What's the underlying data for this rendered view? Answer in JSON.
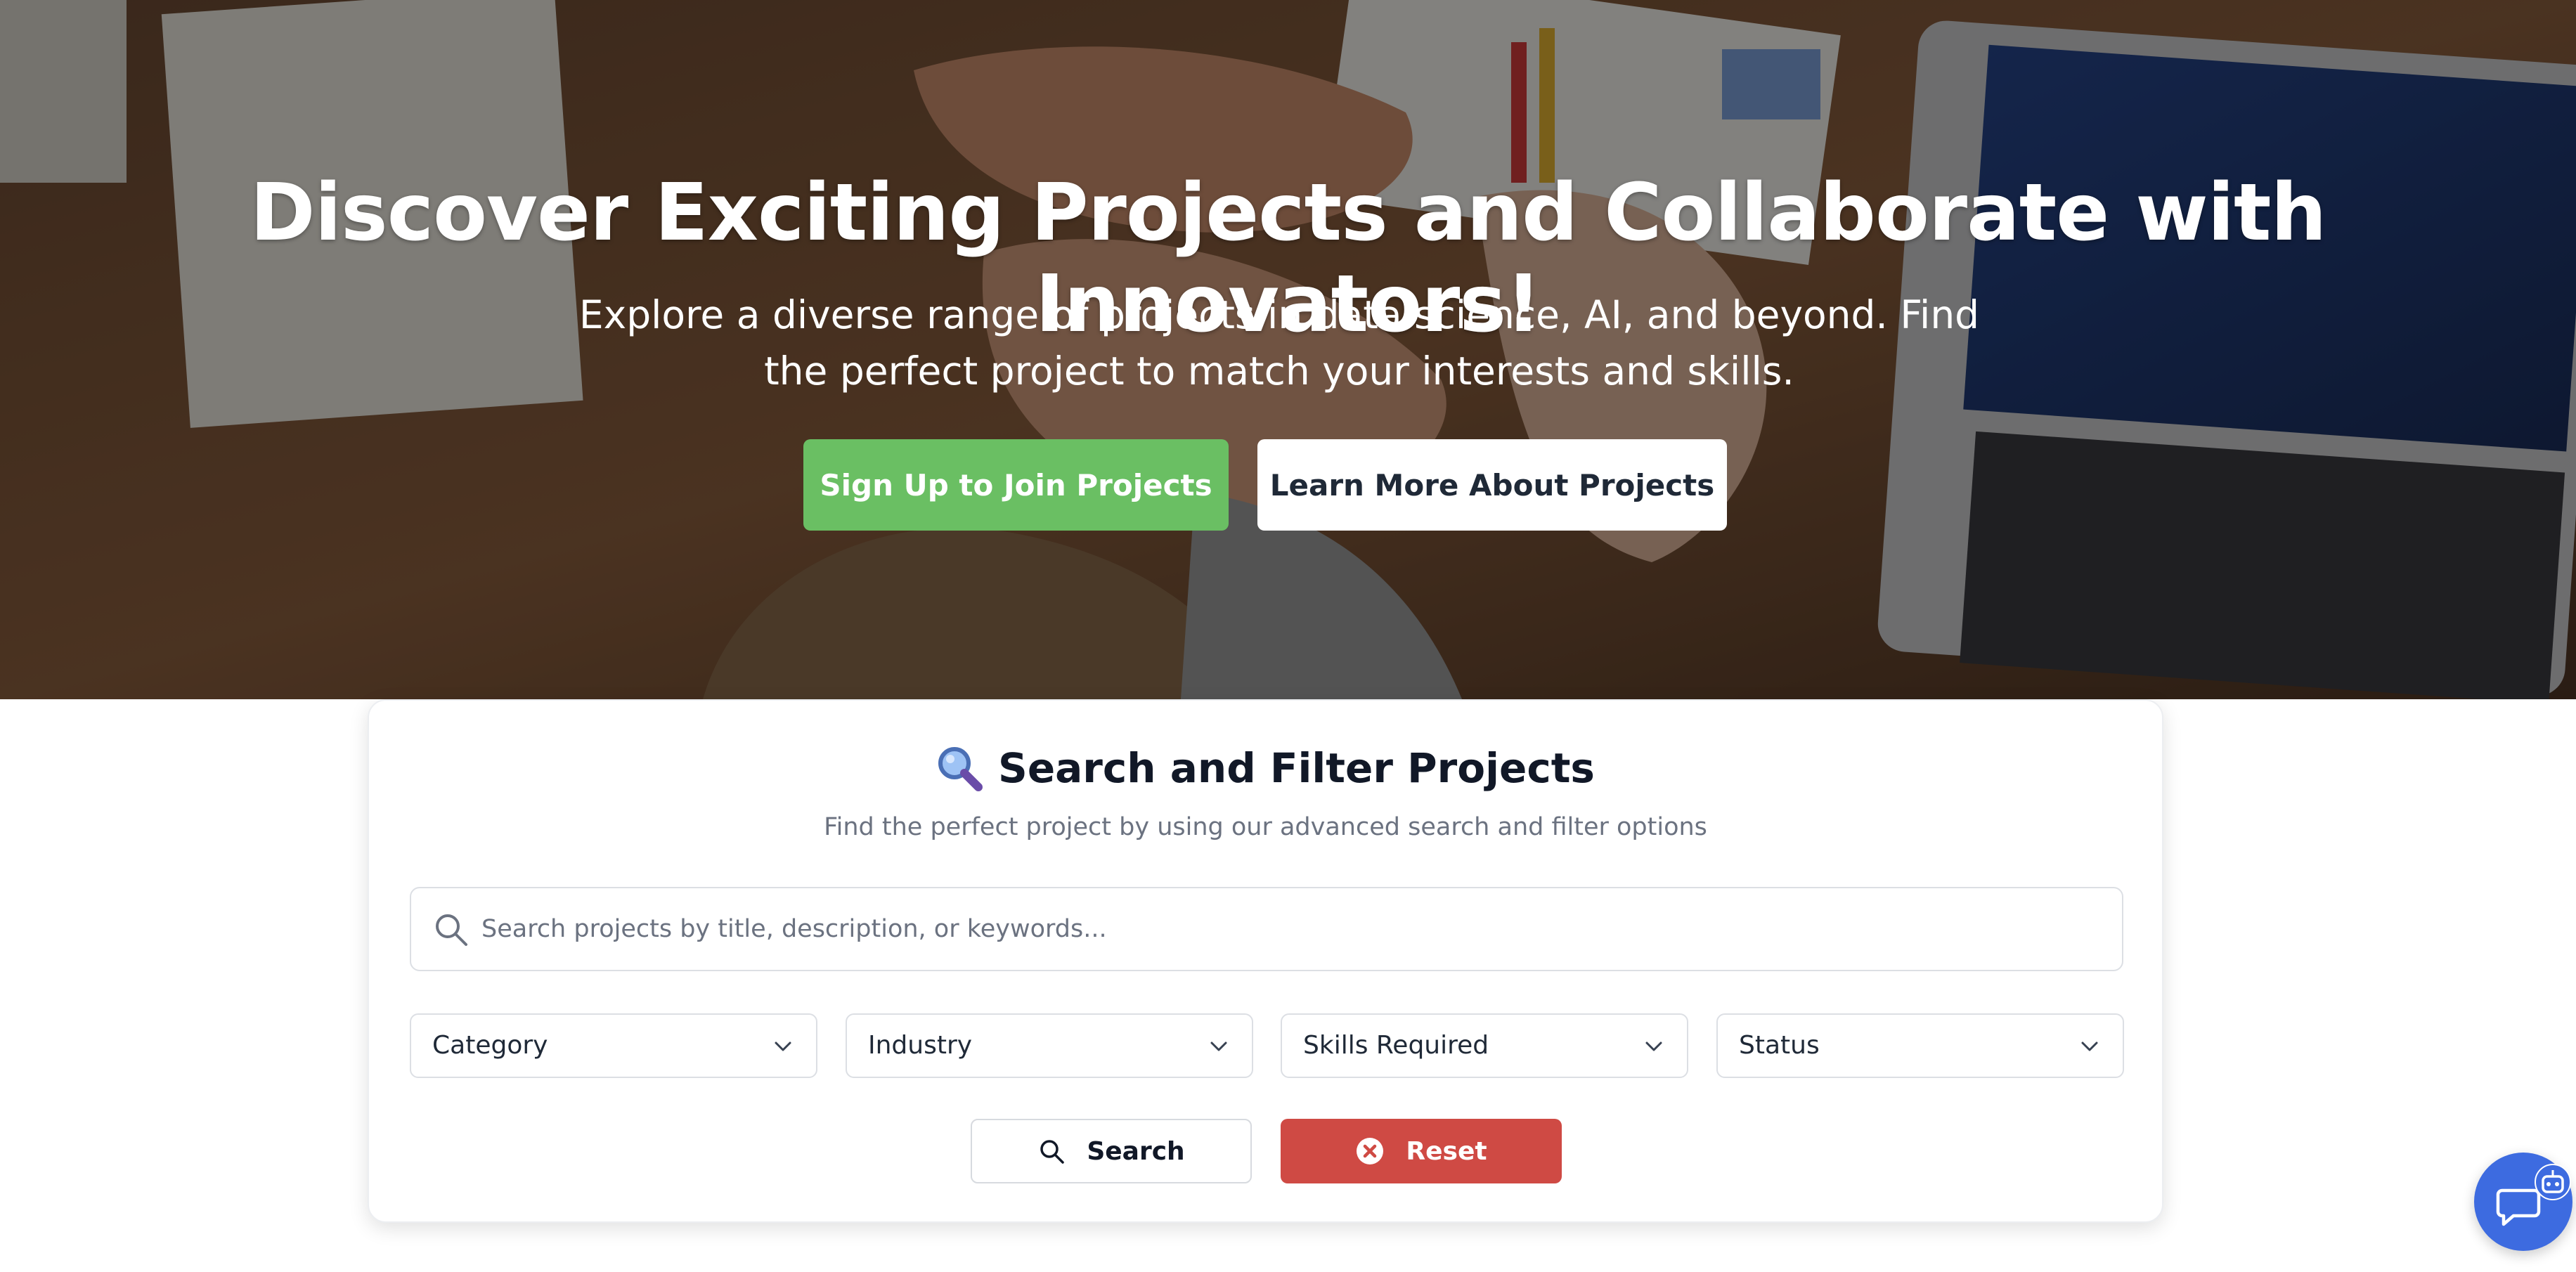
{
  "hero": {
    "title": "Discover Exciting Projects and Collaborate with Innovators!",
    "subtitle": "Explore a diverse range of projects in data science, AI, and beyond. Find the perfect project to match your interests and skills.",
    "signup_label": "Sign Up to Join Projects",
    "learn_label": "Learn More About Projects"
  },
  "search_panel": {
    "title": "Search and Filter Projects",
    "subtitle": "Find the perfect project by using our advanced search and filter options",
    "search_placeholder": "Search projects by title, description, or keywords...",
    "filters": {
      "category": "Category",
      "industry": "Industry",
      "skills": "Skills Required",
      "status": "Status"
    },
    "search_label": "Search",
    "reset_label": "Reset"
  },
  "icons": {
    "heading_icon": "magnifying-glass-emoji",
    "search_field_icon": "search-icon",
    "select_icon": "chevron-down-icon",
    "reset_icon": "close-circle-icon",
    "chat_icon": "chat-bubble-icon",
    "bot_icon": "robot-icon"
  },
  "colors": {
    "signup_button": "#6abf63",
    "reset_button": "#cf4a44",
    "chat_fab": "#3d6be0"
  }
}
